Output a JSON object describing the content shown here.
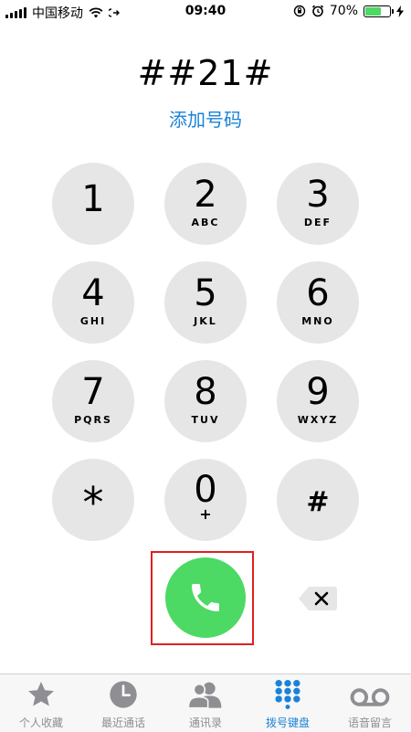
{
  "status_bar": {
    "carrier": "中国移动",
    "time": "09:40",
    "battery": "70%",
    "battery_level": 0.7
  },
  "dialer": {
    "number": "##21#",
    "add_number": "添加号码"
  },
  "keypad": {
    "k1": {
      "digit": "1",
      "letters": ""
    },
    "k2": {
      "digit": "2",
      "letters": "ABC"
    },
    "k3": {
      "digit": "3",
      "letters": "DEF"
    },
    "k4": {
      "digit": "4",
      "letters": "GHI"
    },
    "k5": {
      "digit": "5",
      "letters": "JKL"
    },
    "k6": {
      "digit": "6",
      "letters": "MNO"
    },
    "k7": {
      "digit": "7",
      "letters": "PQRS"
    },
    "k8": {
      "digit": "8",
      "letters": "TUV"
    },
    "k9": {
      "digit": "9",
      "letters": "WXYZ"
    },
    "kstar": {
      "digit": "*",
      "letters": ""
    },
    "k0": {
      "digit": "0",
      "letters": "+"
    },
    "khash": {
      "digit": "#",
      "letters": ""
    }
  },
  "actions": {
    "call_icon": "phone-icon",
    "delete_icon": "backspace-icon"
  },
  "tabs": [
    {
      "label": "个人收藏",
      "icon": "star-icon"
    },
    {
      "label": "最近通话",
      "icon": "clock-icon"
    },
    {
      "label": "通讯录",
      "icon": "contacts-icon"
    },
    {
      "label": "拨号键盘",
      "icon": "keypad-icon",
      "active": true
    },
    {
      "label": "语音留言",
      "icon": "voicemail-icon"
    }
  ],
  "colors": {
    "accent": "#1a82d8",
    "call_green": "#4cd964",
    "key_gray": "#e6e6e6",
    "highlight_red": "#e02020"
  }
}
